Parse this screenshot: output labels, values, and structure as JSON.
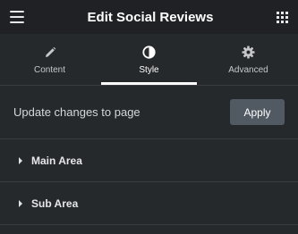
{
  "header": {
    "title": "Edit Social Reviews",
    "menu_icon": "hamburger-menu-icon",
    "apps_icon": "grid-apps-icon"
  },
  "tabs": [
    {
      "label": "Content",
      "icon": "pencil-icon",
      "active": false
    },
    {
      "label": "Style",
      "icon": "half-circle-contrast-icon",
      "active": true
    },
    {
      "label": "Advanced",
      "icon": "gear-icon",
      "active": false
    }
  ],
  "update": {
    "text": "Update changes to page",
    "button_label": "Apply"
  },
  "sections": [
    {
      "label": "Main Area"
    },
    {
      "label": "Sub Area"
    }
  ],
  "colors": {
    "background": "#26292c",
    "header_background": "#1f2124",
    "button_background": "#515962"
  }
}
